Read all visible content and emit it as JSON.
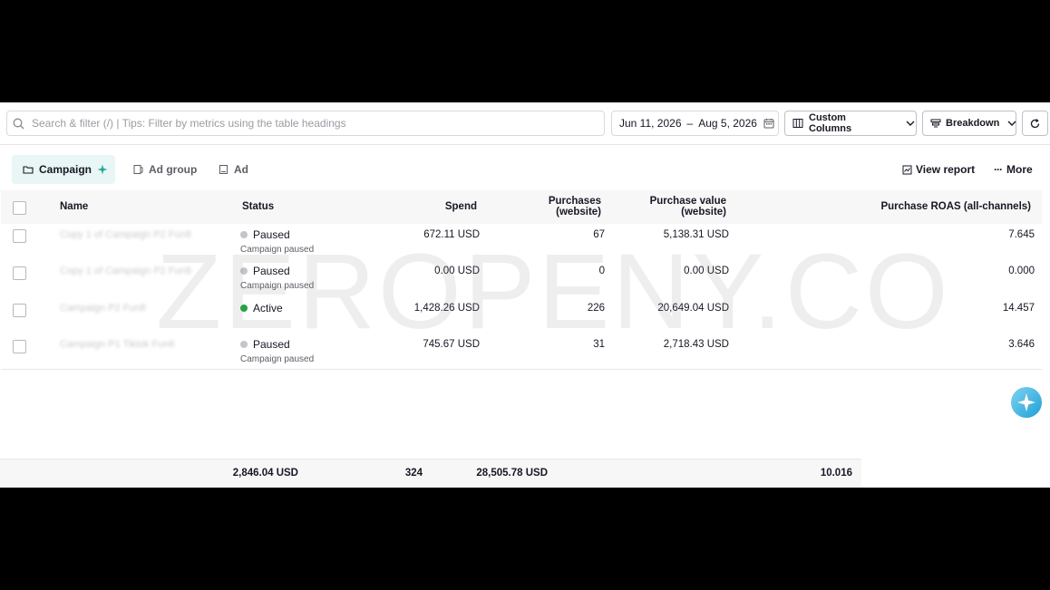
{
  "search": {
    "placeholder": "Search & filter (/) | Tips: Filter by metrics using the table headings"
  },
  "date_range": {
    "start": "Jun 11, 2026",
    "separator": "–",
    "end": "Aug 5, 2026"
  },
  "toolbar": {
    "custom_columns": "Custom Columns",
    "breakdown": "Breakdown"
  },
  "tabs": [
    {
      "label": "Campaign",
      "active": true
    },
    {
      "label": "Ad group",
      "active": false
    },
    {
      "label": "Ad",
      "active": false
    }
  ],
  "actions": {
    "view_report": "View report",
    "more": "More"
  },
  "columns": {
    "name": "Name",
    "status": "Status",
    "spend": "Spend",
    "purchases_l1": "Purchases",
    "purchases_l2": "(website)",
    "pvalue_l1": "Purchase value",
    "pvalue_l2": "(website)",
    "roas": "Purchase ROAS (all-channels)"
  },
  "rows": [
    {
      "name": "Copy 1 of Campaign P2 Fun8",
      "status": "Paused",
      "sub": "Campaign paused",
      "spend": "672.11 USD",
      "purchases": "67",
      "value": "5,138.31 USD",
      "roas": "7.645"
    },
    {
      "name": "Copy 1 of Campaign P2 Fun8",
      "status": "Paused",
      "sub": "Campaign paused",
      "spend": "0.00 USD",
      "purchases": "0",
      "value": "0.00 USD",
      "roas": "0.000"
    },
    {
      "name": "Campaign P2 Fun8",
      "status": "Active",
      "sub": "",
      "spend": "1,428.26 USD",
      "purchases": "226",
      "value": "20,649.04 USD",
      "roas": "14.457"
    },
    {
      "name": "Campaign P1 Tiktok Fun6",
      "status": "Paused",
      "sub": "Campaign paused",
      "spend": "745.67 USD",
      "purchases": "31",
      "value": "2,718.43 USD",
      "roas": "3.646"
    }
  ],
  "totals": {
    "spend": "2,846.04 USD",
    "purchases": "324",
    "value": "28,505.78 USD",
    "roas": "10.016"
  },
  "watermark": "ZEROPENY.CO",
  "colors": {
    "active": "#25a244",
    "paused": "#c4c5ca",
    "accent": "#1aa99a",
    "tab_bg": "#e8f6f5"
  },
  "icons": [
    "search-icon",
    "calendar-icon",
    "columns-icon",
    "chevron-down-icon",
    "breakdown-icon",
    "refresh-icon",
    "folder-icon",
    "ad-group-icon",
    "ad-icon",
    "sparkle-icon",
    "report-icon",
    "more-icon",
    "assistant-icon"
  ]
}
